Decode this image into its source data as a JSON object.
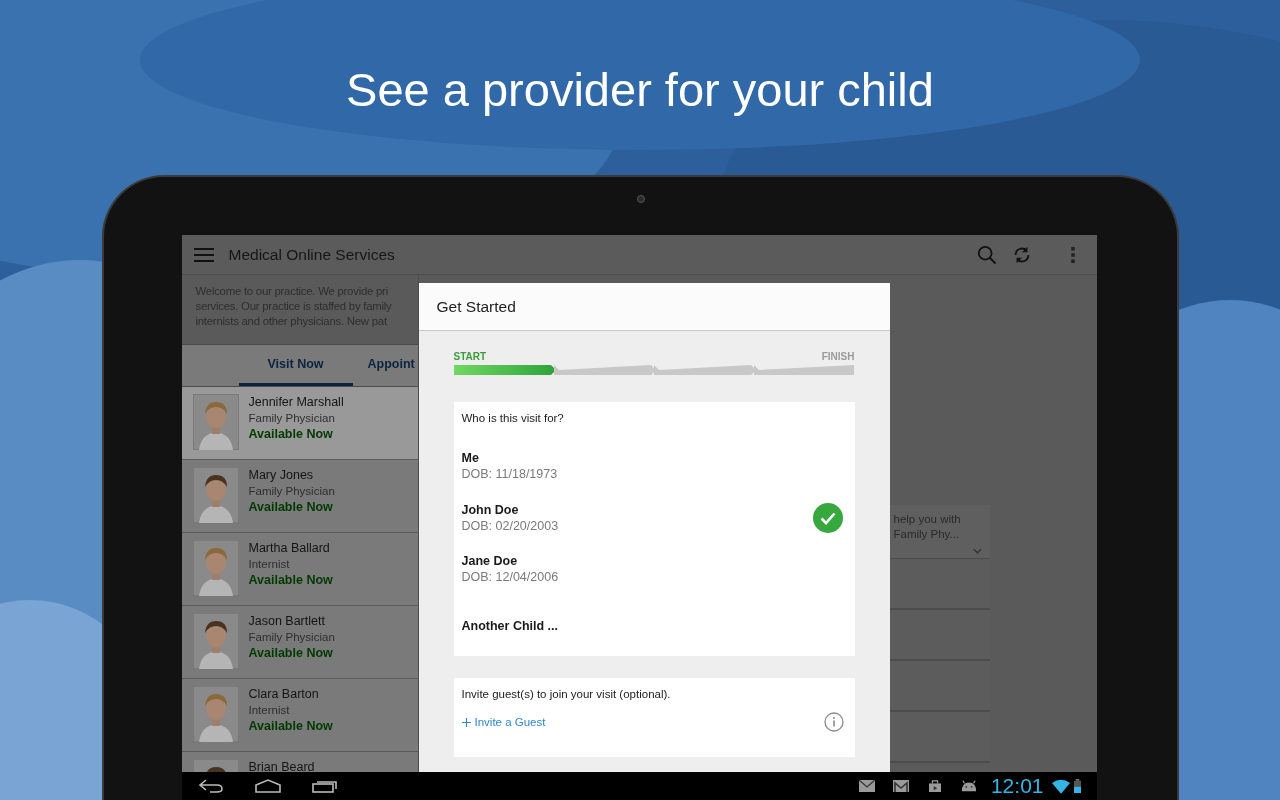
{
  "headline": "See a provider for your child",
  "app_bar": {
    "title": "Medical Online Services"
  },
  "welcome_text": "Welcome to our practice. We provide pri\nservices. Our practice is staffed by family\ninternists and other physicians. New pat",
  "tabs": [
    {
      "label": "Visit Now",
      "selected": true
    },
    {
      "label": "Appoint",
      "selected": false
    }
  ],
  "providers": [
    {
      "name": "Jennifer Marshall",
      "specialty": "Family Physician",
      "availability": "Available Now",
      "selected": true
    },
    {
      "name": "Mary Jones",
      "specialty": "Family Physician",
      "availability": "Available Now",
      "selected": false
    },
    {
      "name": "Martha Ballard",
      "specialty": "Internist",
      "availability": "Available Now",
      "selected": false
    },
    {
      "name": "Jason Bartlett",
      "specialty": "Family Physician",
      "availability": "Available Now",
      "selected": false
    },
    {
      "name": "Clara Barton",
      "specialty": "Internist",
      "availability": "Available Now",
      "selected": false
    },
    {
      "name": "Brian Beard",
      "selected": false
    }
  ],
  "side_card_text": "help you with\nFamily Phy...",
  "dialog": {
    "title": "Get Started",
    "progress": {
      "start_label": "START",
      "end_label": "FINISH",
      "steps": [
        {
          "done": true
        },
        {
          "done": false
        },
        {
          "done": false
        },
        {
          "done": false
        }
      ]
    },
    "question": "Who is this visit for?",
    "options": [
      {
        "name": "Me",
        "dob": "DOB: 11/18/1973",
        "selected": false
      },
      {
        "name": "John Doe",
        "dob": "DOB: 02/20/2003",
        "selected": true
      },
      {
        "name": "Jane Doe",
        "dob": "DOB: 12/04/2006",
        "selected": false
      },
      {
        "name": "Another Child ...",
        "selected": false
      }
    ],
    "guest_prompt": "Invite guest(s) to join your visit (optional).",
    "invite_link": "Invite a Guest"
  },
  "status_bar": {
    "time": "12:01"
  }
}
